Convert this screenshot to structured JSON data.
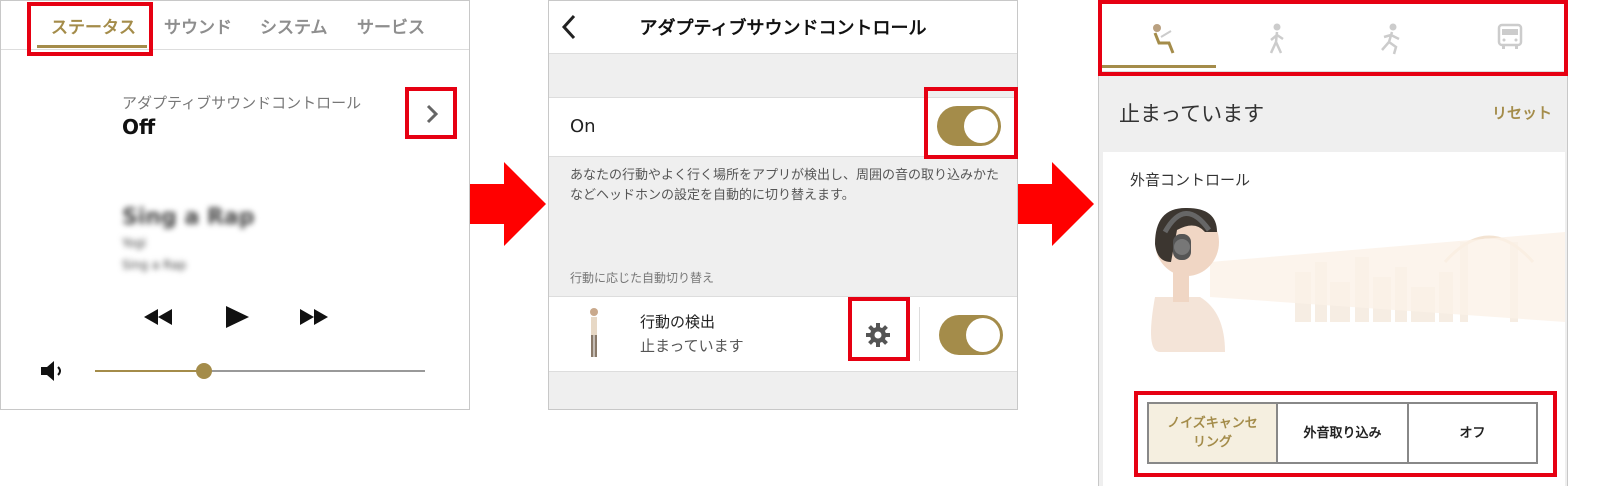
{
  "colors": {
    "accent": "#a48c4a",
    "highlight": "#e60012",
    "arrow": "#ff0000"
  },
  "screen1": {
    "tabs": [
      "ステータス",
      "サウンド",
      "システム",
      "サービス"
    ],
    "adaptive_title": "アダプティブサウンドコントロール",
    "adaptive_value": "Off",
    "chevron_icon": "chevron-right-icon",
    "song_title": "Sing a Rap",
    "song_artist": "Yogi",
    "song_album": "Sing a Rap",
    "player_icons": [
      "rewind-icon",
      "play-icon",
      "fast-forward-icon"
    ],
    "volume_icon": "speaker-icon",
    "volume_level": 0.33
  },
  "screen2": {
    "title": "アダプティブサウンドコントロール",
    "back_icon": "chevron-left-icon",
    "on_label": "On",
    "description": "あなたの行動やよく行く場所をアプリが検出し、周囲の音の取り込みかたなどヘッドホンの設定を自動的に切り替えます。",
    "section_header": "行動に応じた自動切り替え",
    "detect_label": "行動の検出",
    "detect_status": "止まっています",
    "settings_icon": "gear-icon"
  },
  "screen3": {
    "activity_icons": [
      "sitting-person-icon",
      "walking-person-icon",
      "running-person-icon",
      "bus-icon"
    ],
    "status": "止まっています",
    "reset_label": "リセット",
    "section_title": "外音コントロール",
    "buttons": [
      "ノイズキャンセリング",
      "外音取り込み",
      "オフ"
    ]
  }
}
